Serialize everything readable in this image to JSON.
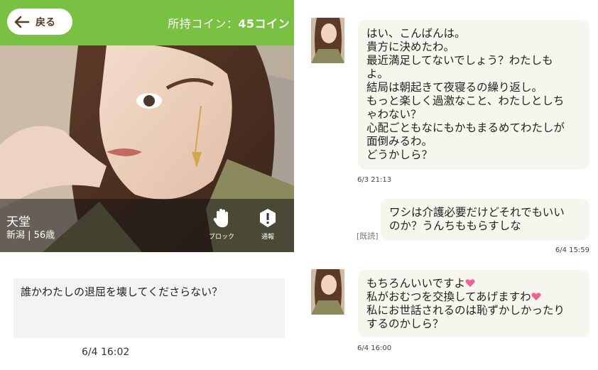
{
  "header": {
    "back_label": "戻る",
    "coin_label": "所持コイン：",
    "coin_value": "45コイン"
  },
  "profile": {
    "name": "天堂",
    "meta": "新潟 | 56歳",
    "block_label": "ブロック",
    "report_label": "通報"
  },
  "my_post": {
    "text": "誰かわたしの退屈を壊してくださらない？",
    "timestamp": "6/4 16:02"
  },
  "chat": {
    "messages": [
      {
        "sender": "partner",
        "lines": [
          "はい、こんばんは。",
          "貴方に決めたわ。",
          "最近満足してないでしょう？わたしも",
          "よ。",
          "結局は朝起きて夜寝るの繰り返し。",
          "もっと楽しく過激なこと、わたしとしち",
          "ゃわない？",
          "心配ごともなにもかもまるめてわたしが",
          "面倒みるわ。",
          "どうかしら？"
        ],
        "timestamp": "6/3 21:13"
      },
      {
        "sender": "me",
        "lines": [
          "ワシは介護必要だけどそれでもいい",
          "のか？うんちももらすしな"
        ],
        "read_label": "[既読]",
        "timestamp": "6/4 15:59"
      },
      {
        "sender": "partner",
        "lines": [
          "もちろんいいですよ",
          "私がおむつを交換してあげますわ",
          "私にお世話されるのは恥ずかしかったり",
          "するのかしら？"
        ],
        "timestamp": "6/4 16:00"
      }
    ]
  },
  "colors": {
    "header_green": "#79c142",
    "bubble_bg": "#f6f6ee",
    "my_post_bg": "#f3f3f3",
    "heart_pink": "#f06292"
  },
  "icons": [
    "arrow-left-icon",
    "hand-icon",
    "alert-icon",
    "heart-icon"
  ]
}
